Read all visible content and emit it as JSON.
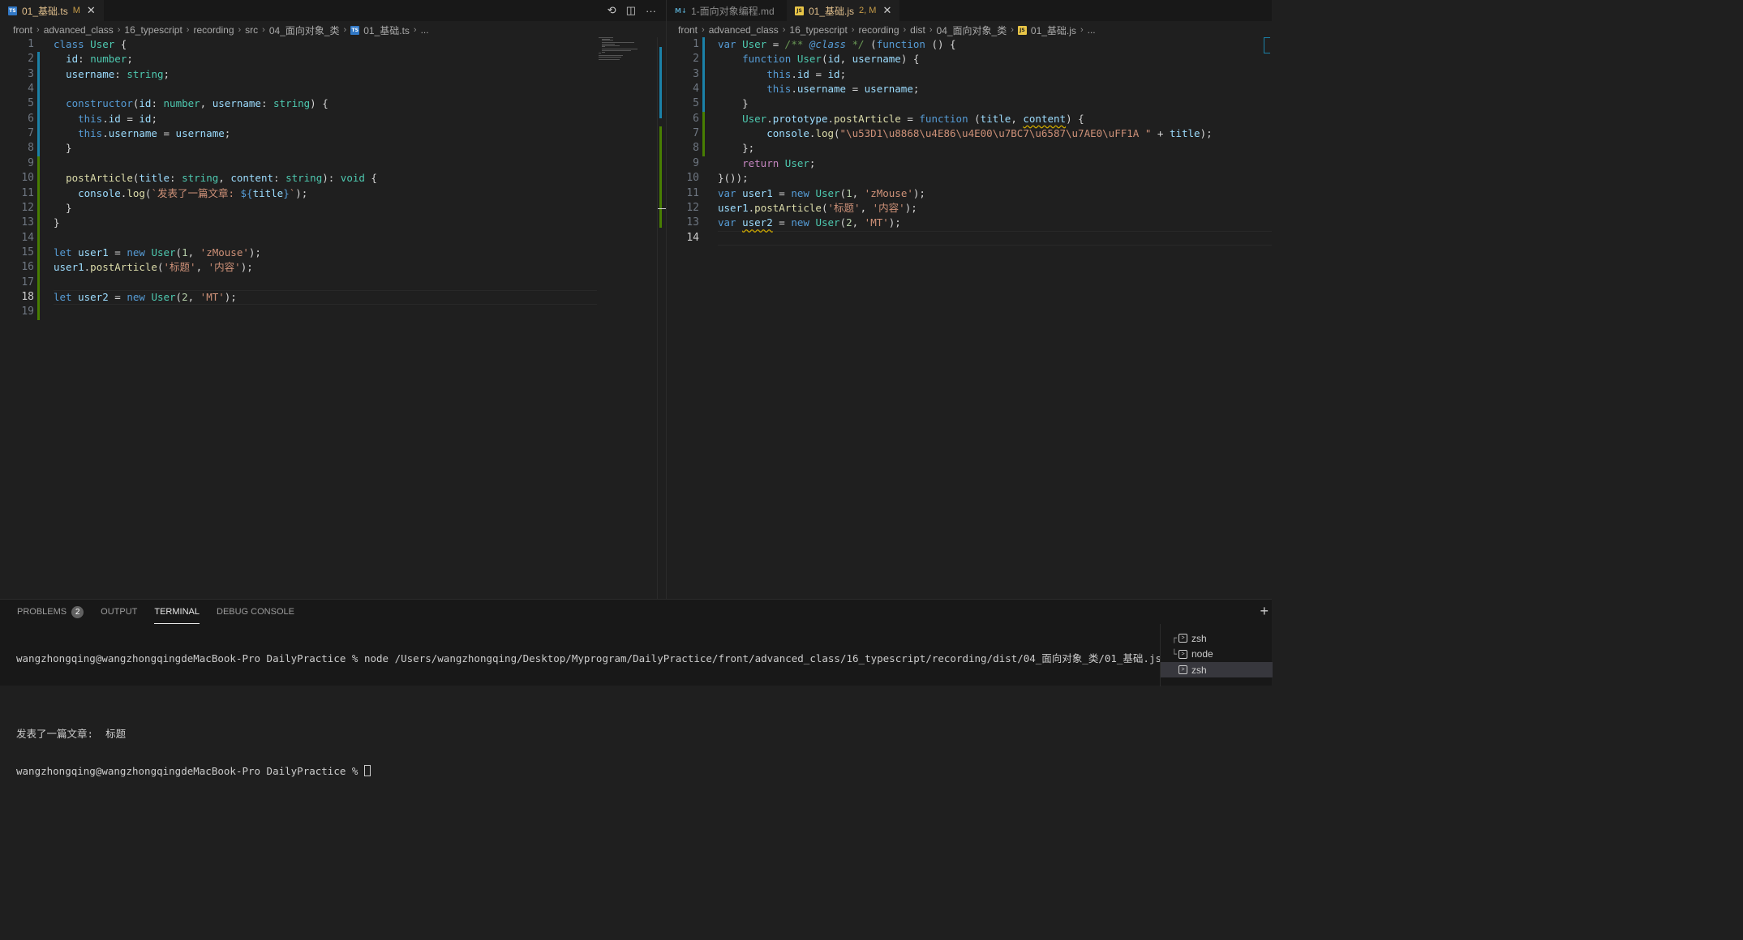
{
  "left_editor": {
    "tab": {
      "label": "01_基础.ts",
      "status": "M",
      "icon": "typescript-file-icon"
    },
    "actions": {
      "compare": "⟲",
      "split": "◫",
      "more": "···"
    },
    "breadcrumb": [
      "front",
      "advanced_class",
      "16_typescript",
      "recording",
      "src",
      "04_面向对象_类",
      "01_基础.ts",
      "..."
    ],
    "current_line": 18,
    "lines": [
      [
        [
          "kw",
          "class"
        ],
        [
          "pu",
          " "
        ],
        [
          "ty",
          "User"
        ],
        [
          "pu",
          " {"
        ]
      ],
      [
        [
          "pu",
          "  "
        ],
        [
          "vr",
          "id"
        ],
        [
          "pu",
          ": "
        ],
        [
          "ty",
          "number"
        ],
        [
          "pu",
          ";"
        ]
      ],
      [
        [
          "pu",
          "  "
        ],
        [
          "vr",
          "username"
        ],
        [
          "pu",
          ": "
        ],
        [
          "ty",
          "string"
        ],
        [
          "pu",
          ";"
        ]
      ],
      [],
      [
        [
          "pu",
          "  "
        ],
        [
          "kw",
          "constructor"
        ],
        [
          "pu",
          "("
        ],
        [
          "vr",
          "id"
        ],
        [
          "pu",
          ": "
        ],
        [
          "ty",
          "number"
        ],
        [
          "pu",
          ", "
        ],
        [
          "vr",
          "username"
        ],
        [
          "pu",
          ": "
        ],
        [
          "ty",
          "string"
        ],
        [
          "pu",
          ") {"
        ]
      ],
      [
        [
          "pu",
          "    "
        ],
        [
          "kw",
          "this"
        ],
        [
          "pu",
          "."
        ],
        [
          "vr",
          "id"
        ],
        [
          "pu",
          " = "
        ],
        [
          "vr",
          "id"
        ],
        [
          "pu",
          ";"
        ]
      ],
      [
        [
          "pu",
          "    "
        ],
        [
          "kw",
          "this"
        ],
        [
          "pu",
          "."
        ],
        [
          "vr",
          "username"
        ],
        [
          "pu",
          " = "
        ],
        [
          "vr",
          "username"
        ],
        [
          "pu",
          ";"
        ]
      ],
      [
        [
          "pu",
          "  }"
        ]
      ],
      [],
      [
        [
          "pu",
          "  "
        ],
        [
          "fn",
          "postArticle"
        ],
        [
          "pu",
          "("
        ],
        [
          "vr",
          "title"
        ],
        [
          "pu",
          ": "
        ],
        [
          "ty",
          "string"
        ],
        [
          "pu",
          ", "
        ],
        [
          "vr",
          "content"
        ],
        [
          "pu",
          ": "
        ],
        [
          "ty",
          "string"
        ],
        [
          "pu",
          "): "
        ],
        [
          "ty",
          "void"
        ],
        [
          "pu",
          " {"
        ]
      ],
      [
        [
          "pu",
          "    "
        ],
        [
          "vr",
          "console"
        ],
        [
          "pu",
          "."
        ],
        [
          "fn",
          "log"
        ],
        [
          "pu",
          "("
        ],
        [
          "st",
          "`发表了一篇文章: "
        ],
        [
          "tpl",
          "${"
        ],
        [
          "vr",
          "title"
        ],
        [
          "tpl",
          "}"
        ],
        [
          "st",
          "`"
        ],
        [
          "pu",
          ");"
        ]
      ],
      [
        [
          "pu",
          "  }"
        ]
      ],
      [
        [
          "pu",
          "}"
        ]
      ],
      [],
      [
        [
          "kw",
          "let"
        ],
        [
          "pu",
          " "
        ],
        [
          "vr",
          "user1"
        ],
        [
          "pu",
          " = "
        ],
        [
          "kw",
          "new"
        ],
        [
          "pu",
          " "
        ],
        [
          "ty",
          "User"
        ],
        [
          "pu",
          "("
        ],
        [
          "nm",
          "1"
        ],
        [
          "pu",
          ", "
        ],
        [
          "st",
          "'zMouse'"
        ],
        [
          "pu",
          ");"
        ]
      ],
      [
        [
          "vr",
          "user1"
        ],
        [
          "pu",
          "."
        ],
        [
          "fn",
          "postArticle"
        ],
        [
          "pu",
          "("
        ],
        [
          "st",
          "'标题'"
        ],
        [
          "pu",
          ", "
        ],
        [
          "st",
          "'内容'"
        ],
        [
          "pu",
          ");"
        ]
      ],
      [],
      [
        [
          "kw",
          "let"
        ],
        [
          "pu",
          " "
        ],
        [
          "vr",
          "user2"
        ],
        [
          "pu",
          " = "
        ],
        [
          "kw",
          "new"
        ],
        [
          "pu",
          " "
        ],
        [
          "ty",
          "User"
        ],
        [
          "pu",
          "("
        ],
        [
          "nm",
          "2"
        ],
        [
          "pu",
          ", "
        ],
        [
          "st",
          "'MT'"
        ],
        [
          "pu",
          ");"
        ]
      ],
      []
    ]
  },
  "right_editor": {
    "tabs": [
      {
        "label": "1-面向对象编程.md",
        "status": "",
        "icon": "markdown-file-icon",
        "active": false
      },
      {
        "label": "01_基础.js",
        "status": "2, M",
        "icon": "javascript-file-icon",
        "active": true
      }
    ],
    "breadcrumb": [
      "front",
      "advanced_class",
      "16_typescript",
      "recording",
      "dist",
      "04_面向对象_类",
      "01_基础.js",
      "..."
    ],
    "current_line": 14,
    "lines": [
      [
        [
          "kw",
          "var"
        ],
        [
          "pu",
          " "
        ],
        [
          "ty",
          "User"
        ],
        [
          "pu",
          " = "
        ],
        [
          "cmt",
          "/** "
        ],
        [
          "cmk",
          "@class"
        ],
        [
          "cmt",
          " */"
        ],
        [
          "pu",
          " ("
        ],
        [
          "kw",
          "function"
        ],
        [
          "pu",
          " () {"
        ]
      ],
      [
        [
          "pu",
          "    "
        ],
        [
          "kw",
          "function"
        ],
        [
          "pu",
          " "
        ],
        [
          "ty",
          "User"
        ],
        [
          "pu",
          "("
        ],
        [
          "vr",
          "id"
        ],
        [
          "pu",
          ", "
        ],
        [
          "vr",
          "username"
        ],
        [
          "pu",
          ") {"
        ]
      ],
      [
        [
          "pu",
          "        "
        ],
        [
          "kw",
          "this"
        ],
        [
          "pu",
          "."
        ],
        [
          "vr",
          "id"
        ],
        [
          "pu",
          " = "
        ],
        [
          "vr",
          "id"
        ],
        [
          "pu",
          ";"
        ]
      ],
      [
        [
          "pu",
          "        "
        ],
        [
          "kw",
          "this"
        ],
        [
          "pu",
          "."
        ],
        [
          "vr",
          "username"
        ],
        [
          "pu",
          " = "
        ],
        [
          "vr",
          "username"
        ],
        [
          "pu",
          ";"
        ]
      ],
      [
        [
          "pu",
          "    }"
        ]
      ],
      [
        [
          "pu",
          "    "
        ],
        [
          "ty",
          "User"
        ],
        [
          "pu",
          "."
        ],
        [
          "vr",
          "prototype"
        ],
        [
          "pu",
          "."
        ],
        [
          "fn",
          "postArticle"
        ],
        [
          "pu",
          " = "
        ],
        [
          "kw",
          "function"
        ],
        [
          "pu",
          " ("
        ],
        [
          "vr",
          "title"
        ],
        [
          "pu",
          ", "
        ],
        [
          "vrs",
          "content"
        ],
        [
          "pu",
          ") {"
        ]
      ],
      [
        [
          "pu",
          "        "
        ],
        [
          "vr",
          "console"
        ],
        [
          "pu",
          "."
        ],
        [
          "fn",
          "log"
        ],
        [
          "pu",
          "("
        ],
        [
          "st",
          "\"\\u53D1\\u8868\\u4E86\\u4E00\\u7BC7\\u6587\\u7AE0\\uFF1A \""
        ],
        [
          "pu",
          " + "
        ],
        [
          "vr",
          "title"
        ],
        [
          "pu",
          ");"
        ]
      ],
      [
        [
          "pu",
          "    };"
        ]
      ],
      [
        [
          "pu",
          "    "
        ],
        [
          "ctl",
          "return"
        ],
        [
          "pu",
          " "
        ],
        [
          "ty",
          "User"
        ],
        [
          "pu",
          ";"
        ]
      ],
      [
        [
          "pu",
          "}());"
        ]
      ],
      [
        [
          "kw",
          "var"
        ],
        [
          "pu",
          " "
        ],
        [
          "vr",
          "user1"
        ],
        [
          "pu",
          " = "
        ],
        [
          "kw",
          "new"
        ],
        [
          "pu",
          " "
        ],
        [
          "ty",
          "User"
        ],
        [
          "pu",
          "("
        ],
        [
          "nm",
          "1"
        ],
        [
          "pu",
          ", "
        ],
        [
          "st",
          "'zMouse'"
        ],
        [
          "pu",
          ");"
        ]
      ],
      [
        [
          "vr",
          "user1"
        ],
        [
          "pu",
          "."
        ],
        [
          "fn",
          "postArticle"
        ],
        [
          "pu",
          "("
        ],
        [
          "st",
          "'标题'"
        ],
        [
          "pu",
          ", "
        ],
        [
          "st",
          "'内容'"
        ],
        [
          "pu",
          ");"
        ]
      ],
      [
        [
          "kw",
          "var"
        ],
        [
          "pu",
          " "
        ],
        [
          "vrs",
          "user2"
        ],
        [
          "pu",
          " = "
        ],
        [
          "kw",
          "new"
        ],
        [
          "pu",
          " "
        ],
        [
          "ty",
          "User"
        ],
        [
          "pu",
          "("
        ],
        [
          "nm",
          "2"
        ],
        [
          "pu",
          ", "
        ],
        [
          "st",
          "'MT'"
        ],
        [
          "pu",
          ");"
        ]
      ],
      []
    ]
  },
  "panel": {
    "tabs": [
      {
        "label": "PROBLEMS",
        "badge": "2",
        "active": false
      },
      {
        "label": "OUTPUT",
        "badge": "",
        "active": false
      },
      {
        "label": "TERMINAL",
        "badge": "",
        "active": true
      },
      {
        "label": "DEBUG CONSOLE",
        "badge": "",
        "active": false
      }
    ],
    "add": "+",
    "terminal": {
      "command_line": "wangzhongqing@wangzhongqingdeMacBook-Pro DailyPractice % node /Users/wangzhongqing/Desktop/Myprogram/DailyPractice/front/advanced_class/16_typescript/recording/dist/04_面向对象_类/01_基础.js",
      "output_line": "发表了一篇文章:  标题",
      "prompt_line": "wangzhongqing@wangzhongqingdeMacBook-Pro DailyPractice % "
    },
    "terminal_list": [
      {
        "label": "zsh",
        "tree": "┌",
        "selected": false
      },
      {
        "label": "node",
        "tree": "└",
        "selected": false
      },
      {
        "label": "zsh",
        "tree": "",
        "selected": true
      }
    ]
  },
  "colors": {
    "accent": "#1b81a8",
    "added": "#487e02",
    "modified": "#c89d48",
    "ts": "#3178c6",
    "js": "#e8c547"
  }
}
